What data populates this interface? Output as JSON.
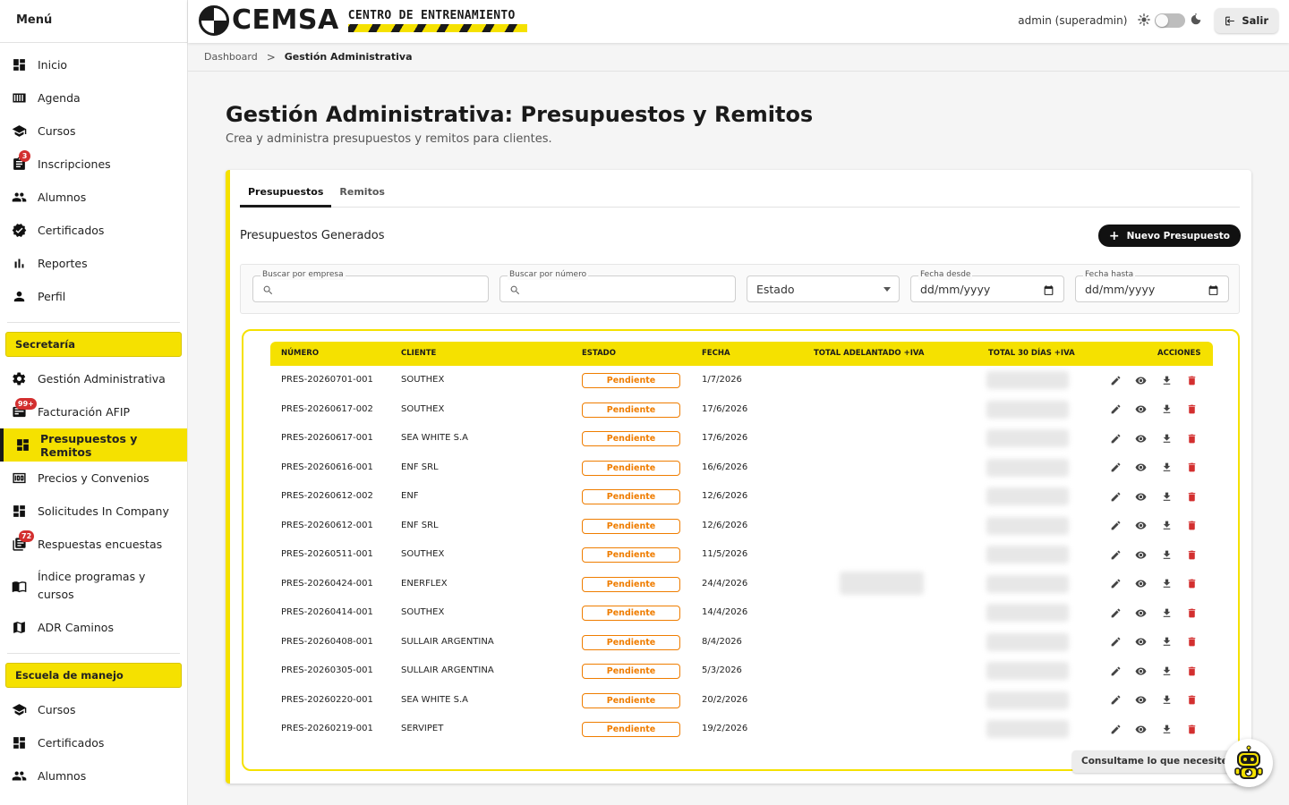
{
  "sidebar": {
    "title": "Menú",
    "items": [
      {
        "label": "Inicio",
        "icon": "dashboard-icon"
      },
      {
        "label": "Agenda",
        "icon": "calendar-view-icon"
      },
      {
        "label": "Cursos",
        "icon": "school-icon"
      },
      {
        "label": "Inscripciones",
        "icon": "clipboard-icon",
        "badge": "3"
      },
      {
        "label": "Alumnos",
        "icon": "people-icon"
      },
      {
        "label": "Certificados",
        "icon": "verified-icon"
      },
      {
        "label": "Reportes",
        "icon": "bar-chart-icon"
      },
      {
        "label": "Perfil",
        "icon": "person-icon"
      }
    ],
    "secretaria": {
      "title": "Secretaría",
      "items": [
        {
          "label": "Gestión Administrativa",
          "icon": "gear-icon"
        },
        {
          "label": "Facturación AFIP",
          "icon": "receipt-icon",
          "badge": "99+"
        },
        {
          "label": "Presupuestos y Remitos",
          "icon": "dashboard-icon"
        },
        {
          "label": "Precios y Convenios",
          "icon": "money-icon"
        },
        {
          "label": "Solicitudes In Company",
          "icon": "dashboard-icon"
        },
        {
          "label": "Respuestas encuestas",
          "icon": "library-books-icon",
          "badge": "72"
        },
        {
          "label": "Índice programas y cursos",
          "icon": "book-open-icon"
        },
        {
          "label": "ADR Caminos",
          "icon": "map-icon"
        }
      ]
    },
    "escuela": {
      "title": "Escuela de manejo",
      "items": [
        {
          "label": "Cursos",
          "icon": "school-icon"
        },
        {
          "label": "Certificados",
          "icon": "dashboard-icon"
        },
        {
          "label": "Alumnos",
          "icon": "people-icon"
        }
      ]
    }
  },
  "header": {
    "logo_text": "CEMSA",
    "logo_subtitle": "CENTRO DE ENTRENAMIENTO",
    "user": "admin (superadmin)",
    "logout_label": "Salir"
  },
  "breadcrumb": {
    "root": "Dashboard",
    "separator": ">",
    "current": "Gestión Administrativa"
  },
  "page": {
    "title": "Gestión Administrativa: Presupuestos y Remitos",
    "subtitle": "Crea y administra presupuestos y remitos para clientes."
  },
  "tabs": [
    "Presupuestos",
    "Remitos"
  ],
  "section": {
    "title": "Presupuestos Generados",
    "new_button": "Nuevo Presupuesto"
  },
  "filters": {
    "empresa_label": "Buscar por empresa",
    "numero_label": "Buscar por número",
    "estado_value": "Estado",
    "desde_label": "Fecha desde",
    "desde_value": "dd/mm/yyyy",
    "hasta_label": "Fecha hasta",
    "hasta_value": "dd/mm/yyyy"
  },
  "table": {
    "columns": [
      "NÚMERO",
      "CLIENTE",
      "ESTADO",
      "FECHA",
      "TOTAL ADELANTADO +IVA",
      "TOTAL 30 DÍAS +IVA",
      "ACCIONES"
    ],
    "rows": [
      {
        "numero": "PRES-20260701-001",
        "cliente": "SOUTHEX",
        "estado": "Pendiente",
        "fecha": "1/7/2026"
      },
      {
        "numero": "PRES-20260617-002",
        "cliente": "SOUTHEX",
        "estado": "Pendiente",
        "fecha": "17/6/2026"
      },
      {
        "numero": "PRES-20260617-001",
        "cliente": "SEA WHITE S.A",
        "estado": "Pendiente",
        "fecha": "17/6/2026"
      },
      {
        "numero": "PRES-20260616-001",
        "cliente": "ENF SRL",
        "estado": "Pendiente",
        "fecha": "16/6/2026"
      },
      {
        "numero": "PRES-20260612-002",
        "cliente": "ENF",
        "estado": "Pendiente",
        "fecha": "12/6/2026"
      },
      {
        "numero": "PRES-20260612-001",
        "cliente": "ENF SRL",
        "estado": "Pendiente",
        "fecha": "12/6/2026"
      },
      {
        "numero": "PRES-20260511-001",
        "cliente": "SOUTHEX",
        "estado": "Pendiente",
        "fecha": "11/5/2026"
      },
      {
        "numero": "PRES-20260424-001",
        "cliente": "ENERFLEX",
        "estado": "Pendiente",
        "fecha": "24/4/2026"
      },
      {
        "numero": "PRES-20260414-001",
        "cliente": "SOUTHEX",
        "estado": "Pendiente",
        "fecha": "14/4/2026"
      },
      {
        "numero": "PRES-20260408-001",
        "cliente": "SULLAIR ARGENTINA",
        "estado": "Pendiente",
        "fecha": "8/4/2026"
      },
      {
        "numero": "PRES-20260305-001",
        "cliente": "SULLAIR ARGENTINA",
        "estado": "Pendiente",
        "fecha": "5/3/2026"
      },
      {
        "numero": "PRES-20260220-001",
        "cliente": "SEA WHITE S.A",
        "estado": "Pendiente",
        "fecha": "20/2/2026"
      },
      {
        "numero": "PRES-20260219-001",
        "cliente": "SERVIPET",
        "estado": "Pendiente",
        "fecha": "19/2/2026"
      }
    ]
  },
  "chat": {
    "bubble": "Consultame lo que necesites"
  },
  "colors": {
    "accent": "#f5e100",
    "dark": "#1a1a1a",
    "pending": "#ef7d00",
    "danger": "#d32f2f",
    "badge": "#d32f2f"
  }
}
